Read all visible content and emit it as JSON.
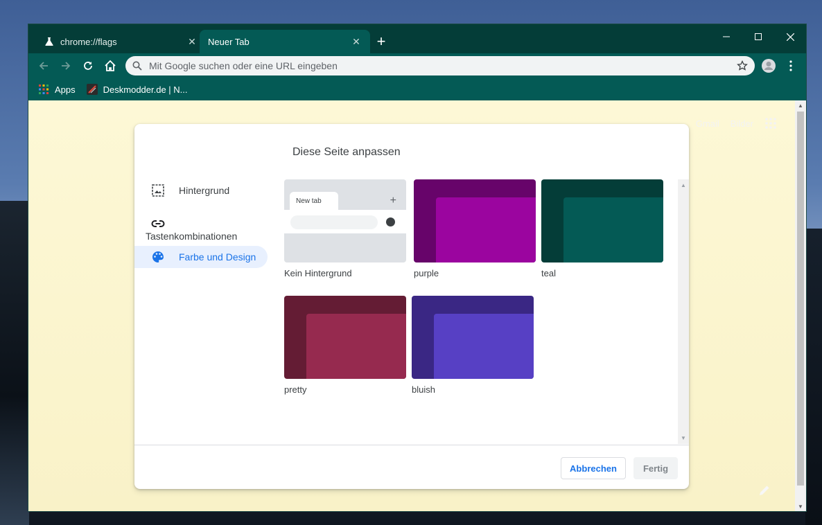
{
  "browser": {
    "tabs": [
      {
        "title": "chrome://flags",
        "icon": "flask-icon",
        "active": false
      },
      {
        "title": "Neuer Tab",
        "icon": "",
        "active": true
      }
    ],
    "omnibox": {
      "placeholder": "Mit Google suchen oder eine URL eingeben",
      "value": ""
    },
    "bookmarks": [
      {
        "label": "Apps",
        "icon": "apps-grid-icon"
      },
      {
        "label": "Deskmodder.de | N...",
        "icon": "deskmodder-favicon"
      }
    ],
    "theme_colors": {
      "frame": "#043d38",
      "toolbar": "#045a55"
    }
  },
  "ntp": {
    "links": [
      "Gmail",
      "Bilder"
    ]
  },
  "dialog": {
    "title": "Diese Seite anpassen",
    "menu": [
      {
        "label": "Hintergrund",
        "icon": "image-icon"
      },
      {
        "label": "Tastenkombinationen",
        "icon": "link-icon"
      },
      {
        "label": "Farbe und Design",
        "icon": "palette-icon",
        "selected": true
      }
    ],
    "themes": [
      {
        "label": "Kein Hintergrund",
        "mini_tab": "New tab"
      },
      {
        "label": "purple",
        "outer": "#67046a",
        "inner": "#9b059f"
      },
      {
        "label": "teal",
        "outer": "#043d38",
        "inner": "#045a55"
      },
      {
        "label": "pretty",
        "outer": "#641c34",
        "inner": "#962a4f"
      },
      {
        "label": "bluish",
        "outer": "#3a2784",
        "inner": "#5740c4"
      }
    ],
    "buttons": {
      "cancel": "Abbrechen",
      "done": "Fertig"
    }
  }
}
